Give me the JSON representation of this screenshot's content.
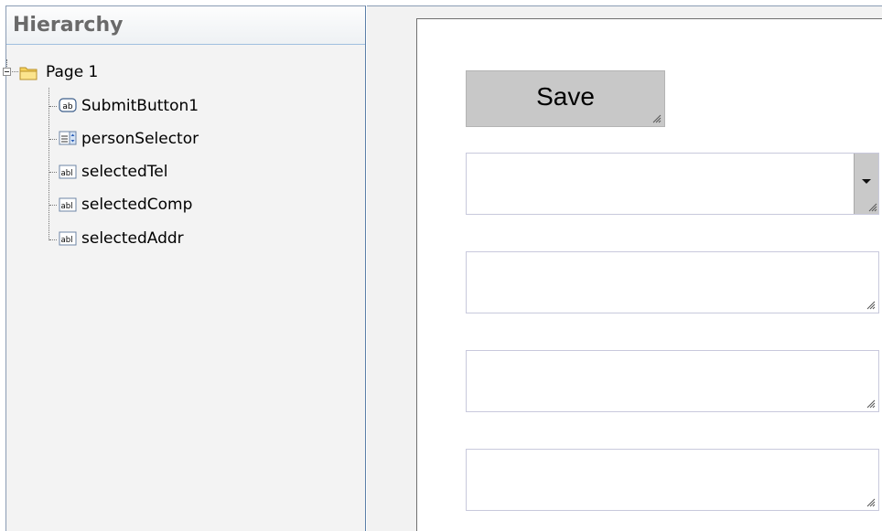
{
  "hierarchy": {
    "title": "Hierarchy",
    "root": {
      "label": "Page 1",
      "icon": "folder-icon"
    },
    "children": [
      {
        "label": "SubmitButton1",
        "icon": "button-ab-icon"
      },
      {
        "label": "personSelector",
        "icon": "list-selector-icon"
      },
      {
        "label": "selectedTel",
        "icon": "textbox-abl-icon"
      },
      {
        "label": "selectedComp",
        "icon": "textbox-abl-icon"
      },
      {
        "label": "selectedAddr",
        "icon": "textbox-abl-icon"
      }
    ]
  },
  "canvas": {
    "save_label": "Save",
    "person_selector_value": "",
    "selected_tel_value": "",
    "selected_comp_value": "",
    "selected_addr_value": ""
  }
}
